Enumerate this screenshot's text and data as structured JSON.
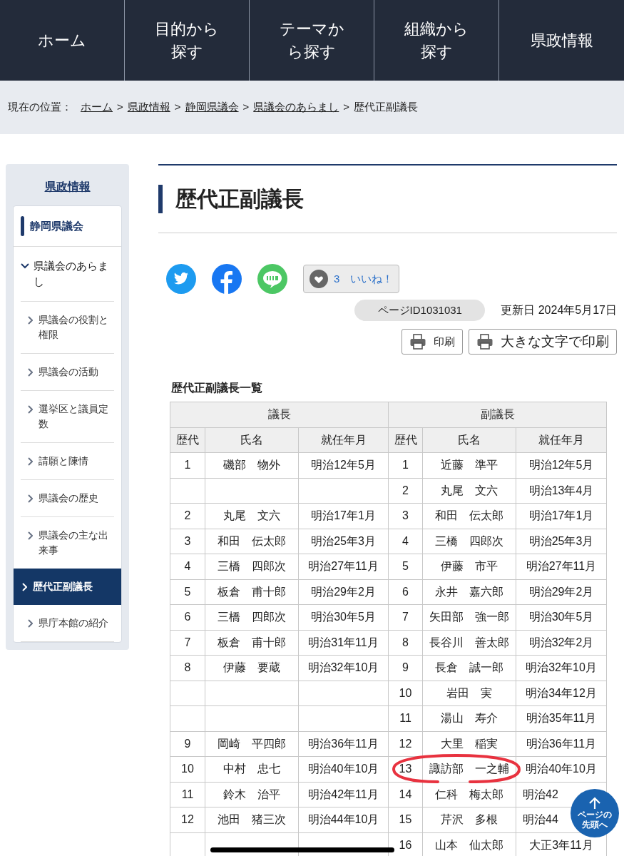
{
  "nav": [
    {
      "label": "ホーム"
    },
    {
      "label": "目的から探す"
    },
    {
      "label": "テーマから探す"
    },
    {
      "label": "組織から探す"
    },
    {
      "label": "県政情報"
    }
  ],
  "breadcrumb": {
    "prefix": "現在の位置：",
    "links": [
      {
        "label": "ホーム",
        "separator": ">"
      },
      {
        "label": "県政情報",
        "separator": ">"
      },
      {
        "label": "静岡県議会",
        "separator": ">"
      },
      {
        "label": "県議会のあらまし",
        "separator": ">"
      }
    ],
    "current": "歴代正副議長"
  },
  "sidebar": {
    "title": "県政情報",
    "items": [
      {
        "label": "静岡県議会",
        "kind": "section"
      },
      {
        "label": "県議会のあらまし",
        "kind": "group",
        "expanded": true,
        "children": [
          {
            "label": "県議会の役割と権限",
            "selected": false
          },
          {
            "label": "県議会の活動",
            "selected": false
          },
          {
            "label": "選挙区と議員定数",
            "selected": false
          },
          {
            "label": "請願と陳情",
            "selected": false
          },
          {
            "label": "県議会の歴史",
            "selected": false
          },
          {
            "label": "県議会の主な出来事",
            "selected": false
          },
          {
            "label": "歴代正副議長",
            "selected": true
          },
          {
            "label": "県庁本館の紹介",
            "selected": false
          }
        ]
      }
    ]
  },
  "page_title": "歴代正副議長",
  "like": {
    "count": "3",
    "label": "いいね！"
  },
  "page_id": "ページID1031031",
  "updated": "更新日 2024年5月17日",
  "print_buttons": [
    "印刷",
    "大きな文字で印刷"
  ],
  "table": {
    "caption": "歴代正副議長一覧",
    "groups": [
      "議長",
      "副議長"
    ],
    "columns": [
      "歴代",
      "氏名",
      "就任年月",
      "歴代",
      "氏名",
      "就任年月"
    ],
    "rows": [
      {
        "chair": [
          "1",
          "磯部　物外",
          "明治12年5月"
        ],
        "vice": [
          "1",
          "近藤　準平",
          "明治12年5月"
        ]
      },
      {
        "vice": [
          "2",
          "丸尾　文六",
          "明治13年4月"
        ]
      },
      {
        "chair": [
          "2",
          "丸尾　文六",
          "明治17年1月"
        ],
        "vice": [
          "3",
          "和田　伝太郎",
          "明治17年1月"
        ]
      },
      {
        "chair": [
          "3",
          "和田　伝太郎",
          "明治25年3月"
        ],
        "vice": [
          "4",
          "三橋　四郎次",
          "明治25年3月"
        ]
      },
      {
        "chair": [
          "4",
          "三橋　四郎次",
          "明治27年11月"
        ],
        "vice": [
          "5",
          "伊藤　市平",
          "明治27年11月"
        ]
      },
      {
        "chair": [
          "5",
          "板倉　甫十郎",
          "明治29年2月"
        ],
        "vice": [
          "6",
          "永井　嘉六郎",
          "明治29年2月"
        ]
      },
      {
        "chair": [
          "6",
          "三橋　四郎次",
          "明治30年5月"
        ],
        "vice": [
          "7",
          "矢田部　強一郎",
          "明治30年5月"
        ]
      },
      {
        "chair": [
          "7",
          "板倉　甫十郎",
          "明治31年11月"
        ],
        "vice": [
          "8",
          "長谷川　善太郎",
          "明治32年2月"
        ]
      },
      {
        "chair": [
          "8",
          "伊藤　要蔵",
          "明治32年10月"
        ],
        "vice": [
          "9",
          "長倉　誠一郎",
          "明治32年10月"
        ]
      },
      {
        "vice": [
          "10",
          "岩田　実",
          "明治34年12月"
        ]
      },
      {
        "vice": [
          "11",
          "湯山　寿介",
          "明治35年11月"
        ]
      },
      {
        "chair": [
          "9",
          "岡崎　平四郎",
          "明治36年11月"
        ],
        "vice": [
          "12",
          "大里　稲実",
          "明治36年11月"
        ]
      },
      {
        "chair": [
          "10",
          "中村　忠七",
          "明治40年10月"
        ],
        "vice": [
          "13",
          "諏訪部　一之輔",
          "明治40年10月"
        ]
      },
      {
        "chair": [
          "11",
          "鈴木　治平",
          "明治42年11月"
        ],
        "vice": [
          "14",
          "仁科　梅太郎",
          "明治42"
        ]
      },
      {
        "chair": [
          "12",
          "池田　猪三次",
          "明治44年10月"
        ],
        "vice": [
          "15",
          "芹沢　多根",
          "明治44"
        ]
      },
      {
        "vice": [
          "16",
          "山本　仙太郎",
          "大正3年11月"
        ]
      }
    ]
  },
  "back_to_top": "ページの先頭へ"
}
